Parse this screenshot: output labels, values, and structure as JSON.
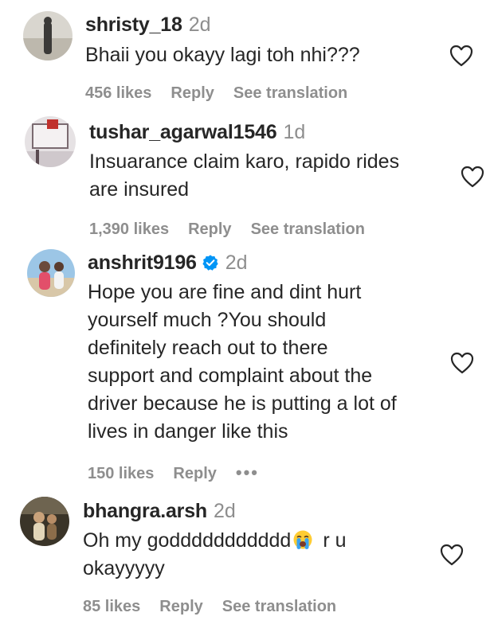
{
  "comments": [
    {
      "username": "shristy_18",
      "time": "2d",
      "text": [
        "Bhaii you okayy lagi toh nhi???"
      ],
      "likes": "456 likes",
      "reply": "Reply",
      "extra": "See translation",
      "verified": false
    },
    {
      "username": "tushar_agarwal1546",
      "time": "1d",
      "text": [
        "Insuarance claim karo, rapido rides",
        "are insured"
      ],
      "likes": "1,390 likes",
      "reply": "Reply",
      "extra": "See translation",
      "verified": false
    },
    {
      "username": "anshrit9196",
      "time": "2d",
      "text": [
        "Hope you are fine and dint hurt",
        "yourself much ?You should",
        "definitely reach out to there",
        "support and complaint about the",
        "driver because he is putting a lot of",
        "lives in danger like this"
      ],
      "likes": "150 likes",
      "reply": "Reply",
      "extra": "•••",
      "verified": true
    },
    {
      "username": "bhangra.arsh",
      "time": "2d",
      "text": [
        "Oh my goddddddddddd",
        "okayyyyy"
      ],
      "text_suffix": "r u",
      "emoji": "crying-face-emoji",
      "likes": "85 likes",
      "reply": "Reply",
      "extra": "See translation",
      "verified": false
    }
  ],
  "colors": {
    "text": "#262626",
    "secondary": "#8e8e8e",
    "verified": "#0095f6",
    "background": "#ffffff"
  },
  "icons": [
    "heart-outline-icon",
    "verified-badge-icon",
    "more-options-icon"
  ]
}
